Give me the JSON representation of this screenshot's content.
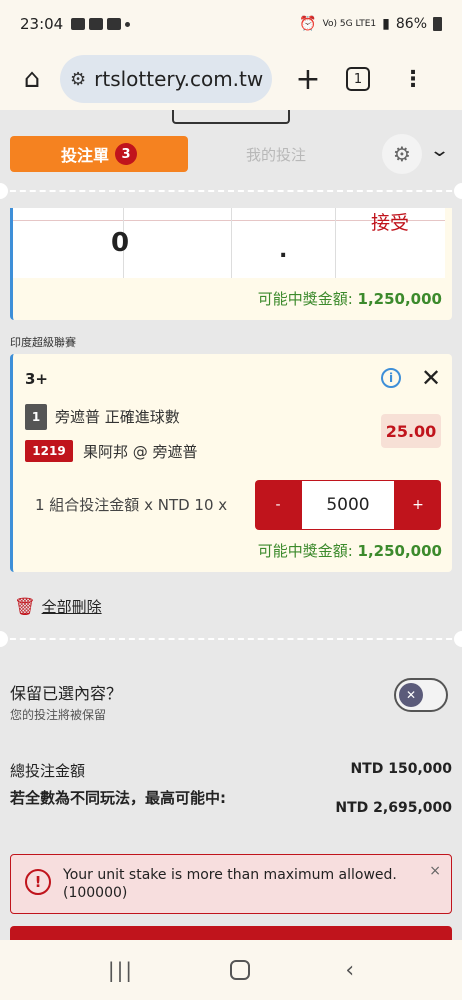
{
  "status_bar": {
    "time": "23:04",
    "network": "Vo) 5G LTE1",
    "battery": "86%"
  },
  "browser": {
    "url": "rtslottery.com.tw",
    "tab_count": "1"
  },
  "bet_tabs": {
    "active_label": "投注單",
    "active_count": "3",
    "inactive_label": "我的投注"
  },
  "card1": {
    "keypad_zero": "0",
    "keypad_dot": ".",
    "keypad_accept": "接受",
    "payout_label": "可能中獎金額:",
    "payout_value": "1,250,000"
  },
  "league": "印度超級聯賽",
  "card2": {
    "bet_type": "3+",
    "selection_number": "1",
    "market": "旁遮普 正確進球數",
    "match_code": "1219",
    "match": "果阿邦 @ 旁遮普",
    "odds": "25.00",
    "stake_label": "1 組合投注金額 x NTD 10 x",
    "minus": "-",
    "stake_value": "5000",
    "plus": "+",
    "payout_label": "可能中獎金額:",
    "payout_value": "1,250,000"
  },
  "delete_all": "全部刪除",
  "retain": {
    "title": "保留已選內容？",
    "subtitle": "您的投注將被保留"
  },
  "totals": {
    "total_label": "總投注金額",
    "total_value": "NTD 150,000",
    "maxwin_label": "若全數為不同玩法，最高可能中:",
    "maxwin_value": "NTD 2,695,000"
  },
  "error": {
    "message": "Your unit stake is more than maximum allowed. (100000)",
    "close": "×"
  },
  "colors": {
    "accent_orange": "#f58220",
    "brand_red": "#c0141c",
    "payout_green": "#3c8a2c",
    "card_border_blue": "#3e8fd8"
  }
}
